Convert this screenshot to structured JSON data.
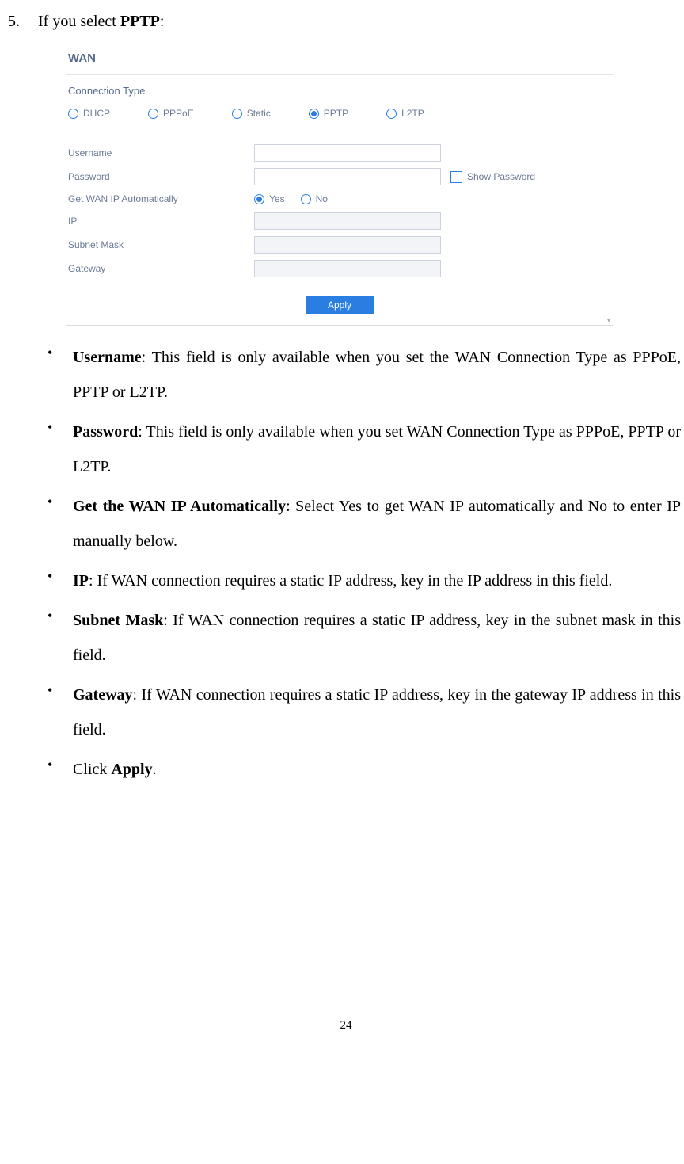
{
  "numbered": {
    "num": "5.",
    "prefix": "If you select ",
    "bold": "PPTP",
    "suffix": ":"
  },
  "form": {
    "title": "WAN",
    "connection_type_label": "Connection Type",
    "types": [
      "DHCP",
      "PPPoE",
      "Static",
      "PPTP",
      "L2TP"
    ],
    "selected_type_index": 3,
    "username_label": "Username",
    "password_label": "Password",
    "show_password_label": "Show Password",
    "get_wan_label": "Get WAN IP Automatically",
    "yes_label": "Yes",
    "no_label": "No",
    "get_wan_selected": "yes",
    "ip_label": "IP",
    "subnet_label": "Subnet Mask",
    "gateway_label": "Gateway",
    "apply_label": "Apply"
  },
  "bullets": [
    {
      "bold": "Username",
      "text": ": This field is only available when you set the WAN Connection Type as PPPoE, PPTP or L2TP."
    },
    {
      "bold": "Password",
      "text": ": This field is only available when you set WAN Connection Type as PPPoE, PPTP or L2TP."
    },
    {
      "bold": "Get the WAN IP Automatically",
      "text": ": Select Yes to get WAN IP automatically and No to enter IP manually below."
    },
    {
      "bold": "IP",
      "text": ": If WAN connection requires a static IP address, key in the IP address in this field."
    },
    {
      "bold": "Subnet Mask",
      "text": ": If WAN connection requires a static IP address, key in the subnet mask in this field."
    },
    {
      "bold": "Gateway",
      "text": ": If WAN connection requires a static IP address, key in the gateway IP address in this field."
    },
    {
      "pre": "Click ",
      "bold": "Apply",
      "text": "."
    }
  ],
  "page_number": "24"
}
